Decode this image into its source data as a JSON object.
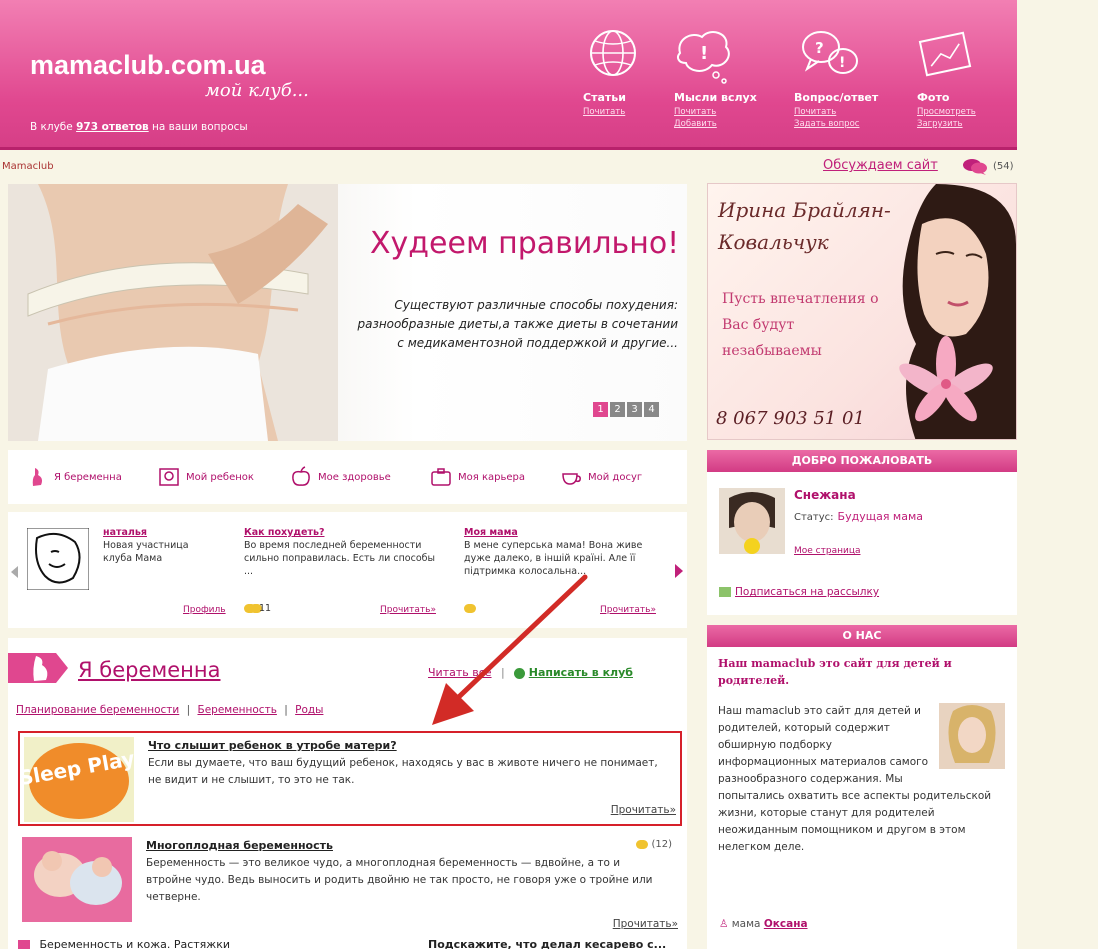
{
  "header": {
    "logo": "mamaclub.com.ua",
    "logo_sub": "мой клуб...",
    "club_prefix": "В клубе",
    "club_answers": "973 ответов",
    "club_suffix": "на ваши вопросы",
    "nav": [
      {
        "title": "Статьи",
        "links": [
          "Почитать"
        ],
        "icon": "globe-icon"
      },
      {
        "title": "Мысли вслух",
        "links": [
          "Почитать",
          "Добавить"
        ],
        "icon": "thought-bubble-icon"
      },
      {
        "title": "Вопрос/ответ",
        "links": [
          "Почитать",
          "Задать вопрос"
        ],
        "icon": "question-bubbles-icon"
      },
      {
        "title": "Фото",
        "links": [
          "Просмотреть",
          "Загрузить"
        ],
        "icon": "photo-icon"
      }
    ]
  },
  "breadcrumb": {
    "home": "Mamaclub",
    "discuss": "Обсуждаем сайт",
    "discuss_count": "(54)"
  },
  "hero": {
    "title": "Худеем правильно!",
    "text": "Существуют различные способы похудения: разнообразные диеты,а также диеты в сочетании с медикаментозной поддержкой и другие...",
    "pages": [
      "1",
      "2",
      "3",
      "4"
    ],
    "active_page": "1"
  },
  "ad": {
    "name": "Ирина Брайлян-Ковальчук",
    "text": "Пусть впечатления о Вас будут незабываемы",
    "phone": "8 067 903 51 01"
  },
  "sections": [
    {
      "label": "Я беременна",
      "icon": "pregnant-icon"
    },
    {
      "label": "Мой ребенок",
      "icon": "baby-icon"
    },
    {
      "label": "Мое здоровье",
      "icon": "apple-icon"
    },
    {
      "label": "Моя карьера",
      "icon": "briefcase-icon"
    },
    {
      "label": "Мой досуг",
      "icon": "cup-icon"
    }
  ],
  "strip": {
    "posts": [
      {
        "title": "наталья",
        "text": "Новая участница клуба Мама",
        "more": "Профиль",
        "comments": "1"
      },
      {
        "title": "Как похудеть?",
        "text": "Во время последней беременности сильно поправилась. Есть ли способы ...",
        "more": "Прочитать»",
        "comments": "1"
      },
      {
        "title": "Моя мама",
        "text": "В мене суперська мама! Вона живе дуже далеко, в іншій країні. Але її підтримка колосальна...",
        "more": "Прочитать»",
        "comments": ""
      }
    ]
  },
  "pregnant": {
    "title": "Я беременна",
    "read_all": "Читать все",
    "write": "Написать в клуб",
    "subs": [
      "Планирование беременности",
      "Беременность",
      "Роды"
    ],
    "articles": [
      {
        "title": "Что слышит ребенок в утробе матери?",
        "text": "Если вы думаете, что ваш будущий ребенок, находясь у вас в животе ничего не понимает, не видит и не слышит, то это не так.",
        "read": "Прочитать»",
        "thumb": "Sleep Play"
      },
      {
        "title": "Многоплодная беременность",
        "text": "Беременность — это великое чудо, а многоплодная беременность — вдвойне, а то и втройне чудо. Ведь выносить и родить двойню не так просто, не говоря уже о тройне или четверне.",
        "read": "Прочитать»",
        "count": "(12)"
      }
    ],
    "partial_left": "Беременность и кожа. Растяжки",
    "partial_right": "Подскажите, что делал кесарево с..."
  },
  "welcome": {
    "head": "ДОБРО ПОЖАЛОВАТЬ",
    "name": "Снежана",
    "status_label": "Статус:",
    "status_value": "Будущая мама",
    "menu": "Мое страница",
    "subscribe": "Подписаться на рассылку"
  },
  "about": {
    "head": "О НАС",
    "title": "Наш mamaclub это сайт для детей и родителей.",
    "text": "Наш mamaclub это сайт для детей и родителей, который содержит обширную подборку информационных материалов самого разнообразного содержания. Мы попытались охватить все аспекты родительской жизни, которые станут для родителей неожиданным помощником и другом в этом нелегком деле.",
    "author_prefix": "мама",
    "author": "Оксана"
  }
}
